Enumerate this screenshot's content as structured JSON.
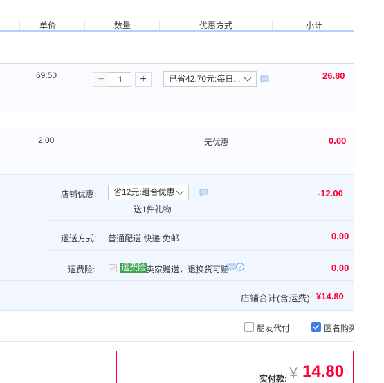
{
  "columns": {
    "unit_price": "单价",
    "quantity": "数量",
    "discount_method": "优惠方式",
    "subtotal": "小计"
  },
  "items": [
    {
      "unit_price": "69.50",
      "quantity": "1",
      "discount_select": "已省42.70元:每日...",
      "subtotal": "26.80"
    },
    {
      "unit_price": "2.00",
      "discount_text": "无优惠",
      "subtotal": "0.00"
    }
  ],
  "shop": {
    "discount_label": "店铺优惠:",
    "discount_select": "省12元:组合优惠",
    "gift_text": "送1件礼物",
    "discount_amount": "-12.00",
    "shipping_label": "运送方式:",
    "shipping_value": "普通配送 快递 免邮",
    "shipping_amount": "0.00",
    "insurance_label": "运费险:",
    "insurance_tag": "运费险",
    "insurance_text": "卖家赠送，退换货可赔",
    "insurance_amount": "0.00",
    "total_label": "店铺合计(含运费)",
    "total_value": "¥14.80"
  },
  "options": {
    "friend_pay_label": "朋友代付",
    "friend_pay_checked": false,
    "anonymous_label": "匿名购买",
    "anonymous_checked": true
  },
  "payment": {
    "label": "实付款:",
    "currency": "¥",
    "amount": "14.80"
  },
  "colors": {
    "price_red": "#ff0036",
    "header_line": "#b2d1ff",
    "checkbox_blue": "#3f7ee8",
    "tag_green": "#3aa450"
  },
  "icons": [
    "minus-icon",
    "plus-icon",
    "chevron-down-icon",
    "message-icon",
    "help-icon",
    "check-icon"
  ]
}
